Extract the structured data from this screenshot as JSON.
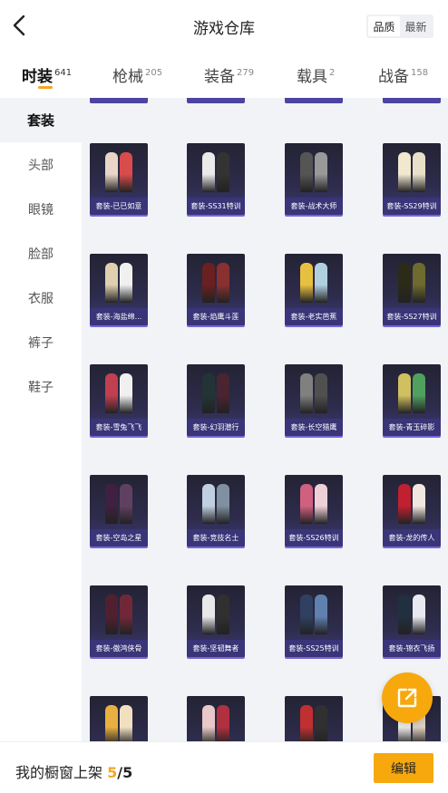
{
  "header": {
    "title": "游戏仓库",
    "sort_options": [
      "品质",
      "最新"
    ],
    "sort_selected": "品质"
  },
  "tabs": [
    {
      "label": "时装",
      "count": "641",
      "active": true
    },
    {
      "label": "枪械",
      "count": "205",
      "active": false
    },
    {
      "label": "装备",
      "count": "279",
      "active": false
    },
    {
      "label": "载具",
      "count": "2",
      "active": false
    },
    {
      "label": "战备",
      "count": "158",
      "active": false
    }
  ],
  "colors": {
    "accent": "#f7a80d",
    "card_bg": "#2e2c4c",
    "card_caption": "#3a3478"
  },
  "sidebar": {
    "items": [
      {
        "label": "套装",
        "active": true
      },
      {
        "label": "头部",
        "active": false
      },
      {
        "label": "眼镜",
        "active": false
      },
      {
        "label": "脸部",
        "active": false
      },
      {
        "label": "衣服",
        "active": false
      },
      {
        "label": "裤子",
        "active": false
      },
      {
        "label": "鞋子",
        "active": false
      }
    ]
  },
  "grid": {
    "items": [
      {
        "name": "套装-已已如意"
      },
      {
        "name": "套装-SS31特训"
      },
      {
        "name": "套装-战术大师"
      },
      {
        "name": "套装-SS29特训"
      },
      {
        "name": "套装-海盐绵..."
      },
      {
        "name": "套装-焰鹰斗莲"
      },
      {
        "name": "套装-老实芭蕉"
      },
      {
        "name": "套装-SS27特训"
      },
      {
        "name": "套装-雪兔飞飞"
      },
      {
        "name": "套装-幻羽潜行"
      },
      {
        "name": "套装-长空猎鹰"
      },
      {
        "name": "套装-青玉碎影"
      },
      {
        "name": "套装-空岛之星"
      },
      {
        "name": "套装-竞技名士"
      },
      {
        "name": "套装-SS26特训"
      },
      {
        "name": "套装-龙的传人"
      },
      {
        "name": "套装-傲鸿侠骨"
      },
      {
        "name": "套装-坚韧舞者"
      },
      {
        "name": "套装-SS25特训"
      },
      {
        "name": "套装-锦衣飞扬"
      },
      {
        "name": ""
      },
      {
        "name": ""
      },
      {
        "name": ""
      },
      {
        "name": ""
      }
    ]
  },
  "bottom": {
    "shelf_label": "我的橱窗上架",
    "shelf_current": "5",
    "shelf_total": "/5",
    "edit_label": "编辑"
  }
}
